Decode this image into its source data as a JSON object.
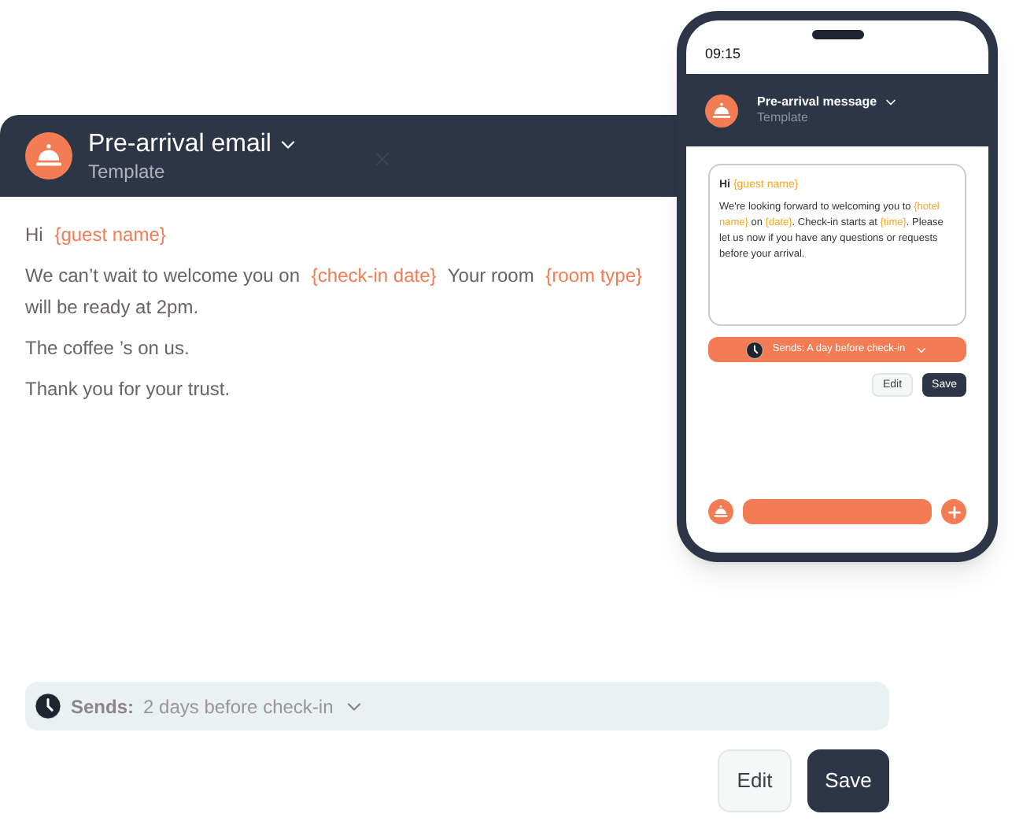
{
  "email": {
    "title": "Pre-arrival email",
    "subtitle": "Template",
    "paragraphs": [
      [
        {
          "kind": "text",
          "text": "Hi"
        },
        {
          "kind": "placeholder",
          "text": "{guest name}"
        }
      ],
      [
        {
          "kind": "text",
          "text": "We can’t wait to welcome you on"
        },
        {
          "kind": "placeholder",
          "text": "{check-in date}"
        },
        {
          "kind": "text",
          "text": "Your room"
        },
        {
          "kind": "placeholder",
          "text": "{room type}"
        },
        {
          "kind": "text",
          "text": "will be ready at 2pm."
        }
      ],
      [
        {
          "kind": "text",
          "text": "The coffee ’s on us."
        }
      ],
      [
        {
          "kind": "text",
          "text": "Thank you for your trust."
        }
      ]
    ],
    "sends": {
      "label": "Sends:",
      "value": "2 days before check-in"
    },
    "buttons": [
      {
        "kind": "secondary",
        "label": "Edit"
      },
      {
        "kind": "primary",
        "label": "Save"
      }
    ]
  },
  "phone": {
    "time": "09:15",
    "title": "Pre-arrival message",
    "subtitle": "Template",
    "greeting": [
      {
        "kind": "text",
        "text": "Hi"
      },
      {
        "kind": "placeholder",
        "text": "{guest name}"
      }
    ],
    "body": [
      {
        "kind": "text",
        "text": "We're looking forward to welcoming you to"
      },
      {
        "kind": "placeholder",
        "text": "{hotel name}"
      },
      {
        "kind": "text",
        "text": "on"
      },
      {
        "kind": "placeholder",
        "text": "{date}"
      },
      {
        "kind": "text",
        "text": ". Check-in starts at"
      },
      {
        "kind": "placeholder",
        "text": "{time}"
      },
      {
        "kind": "text",
        "text": ". Please let us now if you have any questions or requests before your arrival."
      }
    ],
    "sends": "Sends: A day before check-in",
    "buttons": [
      {
        "kind": "secondary",
        "label": "Edit"
      },
      {
        "kind": "primary",
        "label": "Save"
      }
    ]
  }
}
